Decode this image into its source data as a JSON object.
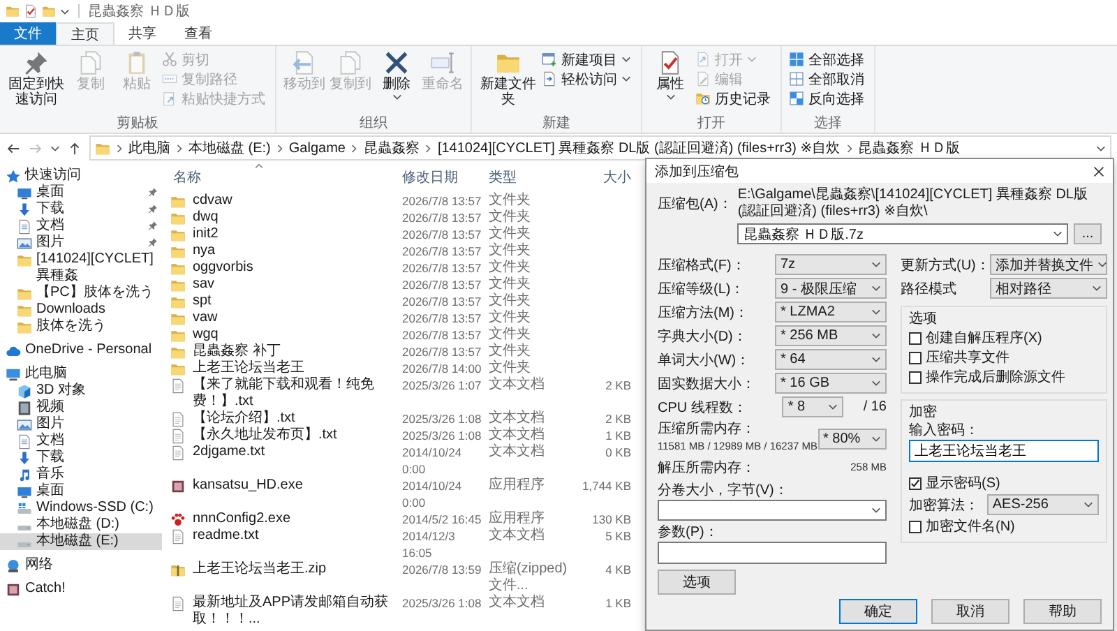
{
  "window": {
    "title": "昆蟲姦察 ＨＤ版"
  },
  "ribbon": {
    "tabs": [
      {
        "label": "文件",
        "kind": "file",
        "selected": false
      },
      {
        "label": "主页",
        "kind": "tab",
        "selected": true
      },
      {
        "label": "共享",
        "kind": "tab",
        "selected": false
      },
      {
        "label": "查看",
        "kind": "tab",
        "selected": false
      }
    ],
    "groups": [
      {
        "label": "剪贴板",
        "items": [
          {
            "label": "固定到快速访问",
            "kind": "large",
            "disabled": false,
            "dropdown": false
          },
          {
            "label": "复制",
            "kind": "large",
            "disabled": true,
            "dropdown": false
          },
          {
            "label": "粘贴",
            "kind": "large",
            "disabled": true,
            "dropdown": false
          },
          {
            "label": "剪切",
            "kind": "small",
            "disabled": true,
            "dropdown": false
          },
          {
            "label": "复制路径",
            "kind": "small",
            "disabled": true,
            "dropdown": false
          },
          {
            "label": "粘贴快捷方式",
            "kind": "small",
            "disabled": true,
            "dropdown": false
          }
        ]
      },
      {
        "label": "组织",
        "items": [
          {
            "label": "移动到",
            "kind": "large",
            "disabled": true,
            "dropdown": false
          },
          {
            "label": "复制到",
            "kind": "large",
            "disabled": true,
            "dropdown": false
          },
          {
            "label": "删除",
            "kind": "large",
            "disabled": false,
            "dropdown": true
          },
          {
            "label": "重命名",
            "kind": "large",
            "disabled": true,
            "dropdown": false
          }
        ]
      },
      {
        "label": "新建",
        "items": [
          {
            "label": "新建文件夹",
            "kind": "large",
            "disabled": false,
            "dropdown": false
          },
          {
            "label": "新建项目",
            "kind": "small",
            "disabled": false,
            "dropdown": true
          },
          {
            "label": "轻松访问",
            "kind": "small",
            "disabled": false,
            "dropdown": true
          }
        ]
      },
      {
        "label": "打开",
        "items": [
          {
            "label": "属性",
            "kind": "large",
            "disabled": false,
            "dropdown": true
          },
          {
            "label": "打开",
            "kind": "small",
            "disabled": true,
            "dropdown": true
          },
          {
            "label": "编辑",
            "kind": "small",
            "disabled": true,
            "dropdown": false
          },
          {
            "label": "历史记录",
            "kind": "small",
            "disabled": false,
            "dropdown": false
          }
        ]
      },
      {
        "label": "选择",
        "items": [
          {
            "label": "全部选择",
            "kind": "small",
            "disabled": false,
            "dropdown": false
          },
          {
            "label": "全部取消",
            "kind": "small",
            "disabled": false,
            "dropdown": false
          },
          {
            "label": "反向选择",
            "kind": "small",
            "disabled": false,
            "dropdown": false
          }
        ]
      }
    ]
  },
  "address": {
    "forward_disabled": true,
    "breadcrumbs": [
      "此电脑",
      "本地磁盘 (E:)",
      "Galgame",
      "昆蟲姦察",
      "[141024][CYCLET] 異種姦察 DL版 (認証回避済) (files+rr3) ※自炊",
      "昆蟲姦察 ＨＤ版"
    ]
  },
  "navigation": [
    {
      "label": "快速访问",
      "kind": "quick",
      "selected": false,
      "children": [
        {
          "label": "桌面",
          "kind": "desktop",
          "selected": false,
          "pinned": true
        },
        {
          "label": "下载",
          "kind": "download",
          "selected": false,
          "pinned": true
        },
        {
          "label": "文档",
          "kind": "document",
          "selected": false,
          "pinned": true
        },
        {
          "label": "图片",
          "kind": "picture",
          "selected": false,
          "pinned": true
        },
        {
          "label": "[141024][CYCLET] 異種姦",
          "kind": "folder",
          "selected": false,
          "pinned": false
        },
        {
          "label": "【PC】肢体を洗う",
          "kind": "folder",
          "selected": false,
          "pinned": false
        },
        {
          "label": "Downloads",
          "kind": "folder",
          "selected": false,
          "pinned": false
        },
        {
          "label": "肢体を洗う",
          "kind": "folder",
          "selected": false,
          "pinned": false
        }
      ]
    },
    {
      "label": "OneDrive - Personal",
      "kind": "cloud",
      "selected": false
    },
    {
      "label": "此电脑",
      "kind": "pc",
      "selected": false,
      "children": [
        {
          "label": "3D 对象",
          "kind": "objects",
          "selected": false
        },
        {
          "label": "视频",
          "kind": "video",
          "selected": false
        },
        {
          "label": "图片",
          "kind": "picture",
          "selected": false
        },
        {
          "label": "文档",
          "kind": "document",
          "selected": false
        },
        {
          "label": "下载",
          "kind": "download",
          "selected": false
        },
        {
          "label": "音乐",
          "kind": "music",
          "selected": false
        },
        {
          "label": "桌面",
          "kind": "desktop",
          "selected": false
        },
        {
          "label": "Windows-SSD (C:)",
          "kind": "system-drive",
          "selected": false
        },
        {
          "label": "本地磁盘 (D:)",
          "kind": "drive",
          "selected": false
        },
        {
          "label": "本地磁盘 (E:)",
          "kind": "drive",
          "selected": true
        }
      ]
    },
    {
      "label": "网络",
      "kind": "network",
      "selected": false
    },
    {
      "label": "Catch!",
      "kind": "app",
      "selected": false
    }
  ],
  "files": {
    "columns": [
      "名称",
      "修改日期",
      "类型",
      "大小"
    ],
    "rows": [
      {
        "name": "cdvaw",
        "date": "2026/7/8 13:57",
        "type": "文件夹",
        "kind": "folder"
      },
      {
        "name": "dwq",
        "date": "2026/7/8 13:57",
        "type": "文件夹",
        "kind": "folder"
      },
      {
        "name": "init2",
        "date": "2026/7/8 13:57",
        "type": "文件夹",
        "kind": "folder"
      },
      {
        "name": "nya",
        "date": "2026/7/8 13:57",
        "type": "文件夹",
        "kind": "folder"
      },
      {
        "name": "oggvorbis",
        "date": "2026/7/8 13:57",
        "type": "文件夹",
        "kind": "folder"
      },
      {
        "name": "sav",
        "date": "2026/7/8 13:57",
        "type": "文件夹",
        "kind": "folder"
      },
      {
        "name": "spt",
        "date": "2026/7/8 13:57",
        "type": "文件夹",
        "kind": "folder"
      },
      {
        "name": "vaw",
        "date": "2026/7/8 13:57",
        "type": "文件夹",
        "kind": "folder"
      },
      {
        "name": "wgq",
        "date": "2026/7/8 13:57",
        "type": "文件夹",
        "kind": "folder"
      },
      {
        "name": "昆蟲姦察 补丁",
        "date": "2026/7/8 13:57",
        "type": "文件夹",
        "kind": "folder"
      },
      {
        "name": "上老王论坛当老王",
        "date": "2026/7/8 14:00",
        "type": "文件夹",
        "kind": "folder"
      },
      {
        "name": "【来了就能下载和观看！纯免费！】.txt",
        "date": "2025/3/26 1:07",
        "type": "文本文档",
        "size": "2 KB",
        "kind": "text"
      },
      {
        "name": "【论坛介绍】.txt",
        "date": "2025/3/26 1:08",
        "type": "文本文档",
        "size": "2 KB",
        "kind": "text"
      },
      {
        "name": "【永久地址发布页】.txt",
        "date": "2025/3/26 1:08",
        "type": "文本文档",
        "size": "1 KB",
        "kind": "text"
      },
      {
        "name": "2djgame.txt",
        "date": "2014/10/24 0:00",
        "type": "文本文档",
        "size": "0 KB",
        "kind": "text"
      },
      {
        "name": "kansatsu_HD.exe",
        "date": "2014/10/24 0:00",
        "type": "应用程序",
        "size": "1,744 KB",
        "kind": "app"
      },
      {
        "name": "nnnConfig2.exe",
        "date": "2014/5/2 16:45",
        "type": "应用程序",
        "size": "130 KB",
        "kind": "config"
      },
      {
        "name": "readme.txt",
        "date": "2014/12/3 16:05",
        "type": "文本文档",
        "size": "5 KB",
        "kind": "text"
      },
      {
        "name": "上老王论坛当老王.zip",
        "date": "2026/7/8 13:59",
        "type": "压缩(zipped)文件...",
        "size": "4 KB",
        "kind": "zip"
      },
      {
        "name": "最新地址及APP请发邮箱自动获取！！！...",
        "date": "2025/3/26 1:08",
        "type": "文本文档",
        "size": "1 KB",
        "kind": "text"
      }
    ]
  },
  "dialog": {
    "title": "添加到压缩包",
    "archive": {
      "label": "压缩包(A)：",
      "path": "E:\\Galgame\\昆蟲姦察\\[141024][CYCLET] 異種姦察 DL版 (認証回避済) (files+rr3) ※自炊\\",
      "name": "昆蟲姦察 ＨＤ版.7z",
      "browse": "..."
    },
    "settings": [
      {
        "label": "压缩格式(F)：",
        "value": "7z"
      },
      {
        "label": "压缩等级(L)：",
        "value": "9 - 极限压缩"
      },
      {
        "label": "压缩方法(M)：",
        "value": "* LZMA2"
      },
      {
        "label": "字典大小(D)：",
        "value": "* 256 MB"
      },
      {
        "label": "单词大小(W)：",
        "value": "* 64"
      },
      {
        "label": "固实数据大小：",
        "value": "* 16 GB"
      },
      {
        "label": "CPU 线程数：",
        "value": "* 8",
        "suffix": "/ 16"
      }
    ],
    "memory": {
      "label": "压缩所需内存：",
      "detail": "11581 MB / 12989 MB / 16237 MB",
      "value": "* 80%"
    },
    "decompress": {
      "label": "解压所需内存：",
      "value": "258 MB"
    },
    "volume": {
      "label": "分卷大小，字节(V)："
    },
    "parameters": {
      "label": "参数(P)："
    },
    "options_button": "选项",
    "update": {
      "label": "更新方式(U)：",
      "value": "添加并替换文件"
    },
    "path_mode": {
      "label": "路径模式",
      "value": "相对路径"
    },
    "options": {
      "title": "选项",
      "checkboxes": [
        {
          "label": "创建自解压程序(X)",
          "checked": false
        },
        {
          "label": "压缩共享文件",
          "checked": false
        },
        {
          "label": "操作完成后删除源文件",
          "checked": false
        }
      ]
    },
    "encryption": {
      "title": "加密",
      "password_label": "输入密码：",
      "password": "上老王论坛当老王",
      "show_password": {
        "label": "显示密码(S)",
        "checked": true
      },
      "method_label": "加密算法：",
      "method": "AES-256",
      "encrypt_names": {
        "label": "加密文件名(N)",
        "checked": false
      }
    },
    "buttons": [
      {
        "label": "确定",
        "default": true
      },
      {
        "label": "取消",
        "default": false
      },
      {
        "label": "帮助",
        "default": false
      }
    ]
  }
}
